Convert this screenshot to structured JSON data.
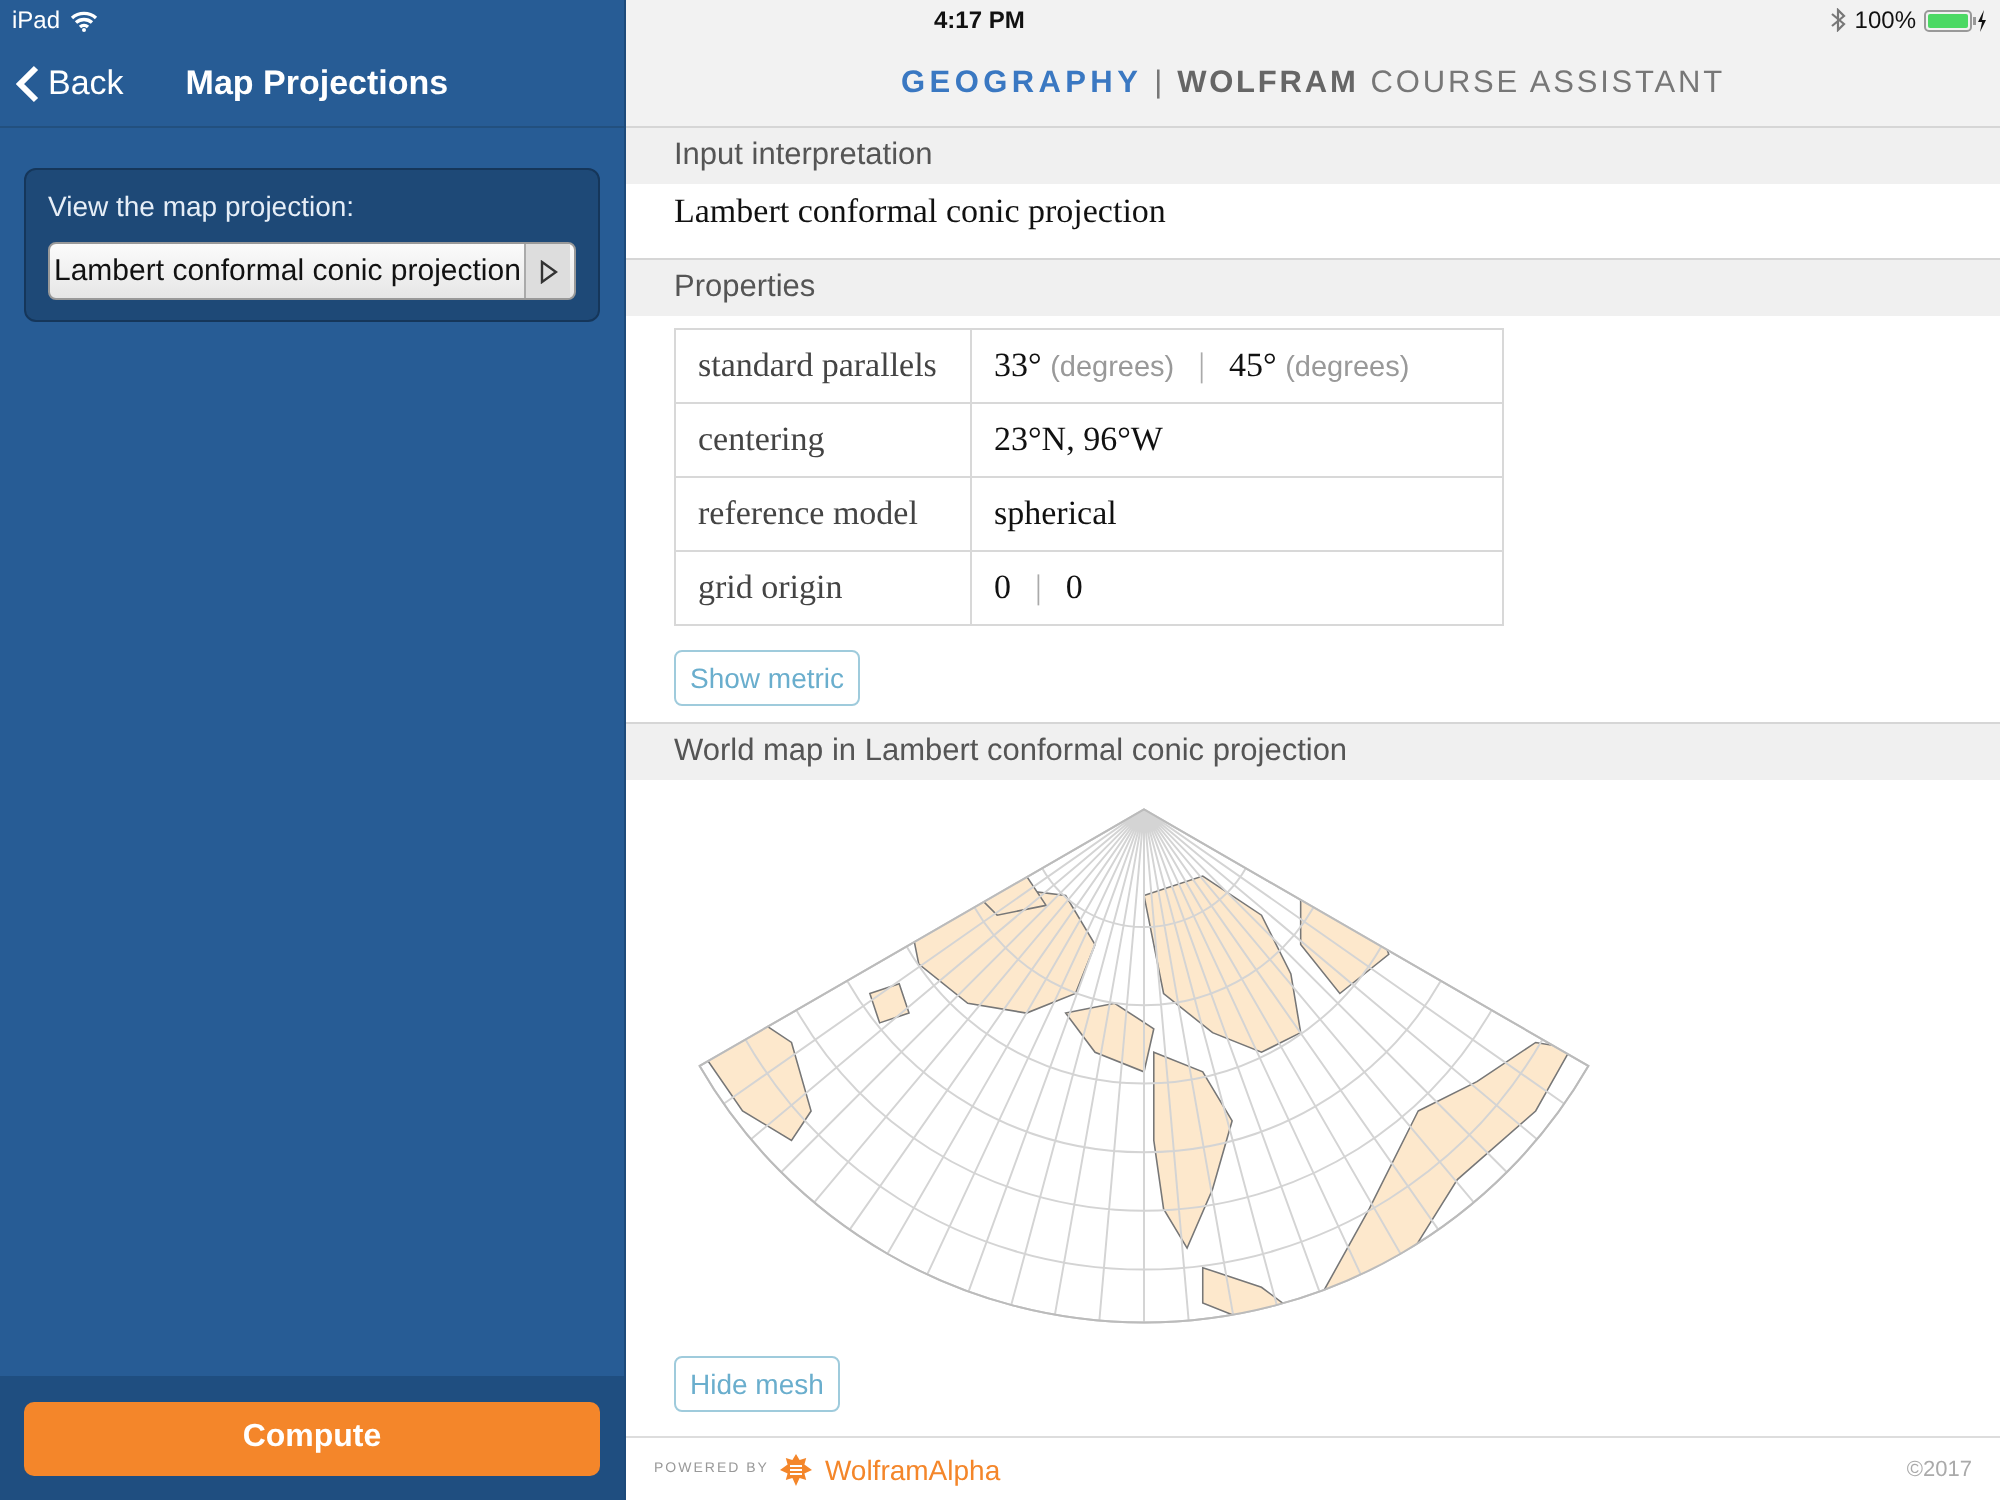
{
  "status_bar": {
    "carrier": "iPad",
    "time": "4:17 PM",
    "battery": "100%"
  },
  "sidebar": {
    "back": "Back",
    "title": "Map Projections",
    "field_label": "View the map projection:",
    "selection": "Lambert conformal conic projection",
    "compute": "Compute"
  },
  "header": {
    "subject": "GEOGRAPHY",
    "separator": "|",
    "brand": "WOLFRAM",
    "product": "COURSE ASSISTANT"
  },
  "pods": [
    {
      "kind": "text",
      "title": "Input interpretation",
      "text": "Lambert conformal conic projection"
    },
    {
      "kind": "table",
      "title": "Properties",
      "separator": "|",
      "rows": [
        {
          "label": "standard parallels",
          "values": [
            {
              "value": "33°",
              "unit": "(degrees)"
            },
            {
              "value": "45°",
              "unit": "(degrees)"
            }
          ]
        },
        {
          "label": "centering",
          "values": [
            {
              "value": "23°N, 96°W"
            }
          ]
        },
        {
          "label": "reference model",
          "values": [
            {
              "value": "spherical"
            }
          ]
        },
        {
          "label": "grid origin",
          "values": [
            {
              "value": "0"
            },
            {
              "value": "0"
            }
          ]
        }
      ],
      "button": "Show metric"
    },
    {
      "kind": "map",
      "title": "World map in Lambert conformal conic projection",
      "button": "Hide mesh"
    }
  ],
  "footer": {
    "powered_by": "POWERED BY",
    "logo": "WolframAlpha",
    "copyright": "©2017"
  }
}
